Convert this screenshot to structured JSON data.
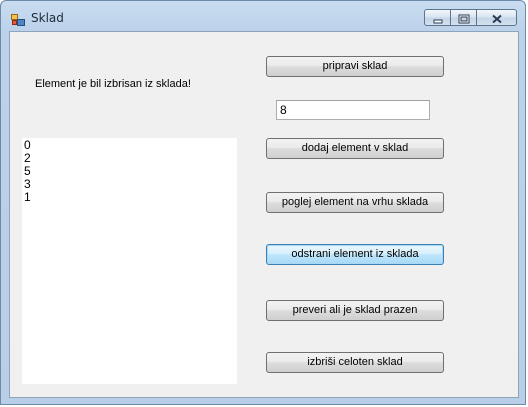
{
  "window": {
    "title": "Sklad"
  },
  "main": {
    "status_label": "Element je bil izbrisan iz sklada!",
    "stack_items": [
      "0",
      "2",
      "5",
      "3",
      "1"
    ],
    "input_value": "8"
  },
  "buttons": {
    "prepare": "pripravi sklad",
    "add": "dodaj element v sklad",
    "peek": "poglej element na vrhu sklada",
    "remove": "odstrani element iz sklada",
    "check_empty": "preveri ali je sklad prazen",
    "clear": "izbriši celoten sklad"
  },
  "colors": {
    "window_frame": "#b9cfe7",
    "client_bg": "#f0f0f0",
    "focus_border": "#3c7fb1"
  }
}
